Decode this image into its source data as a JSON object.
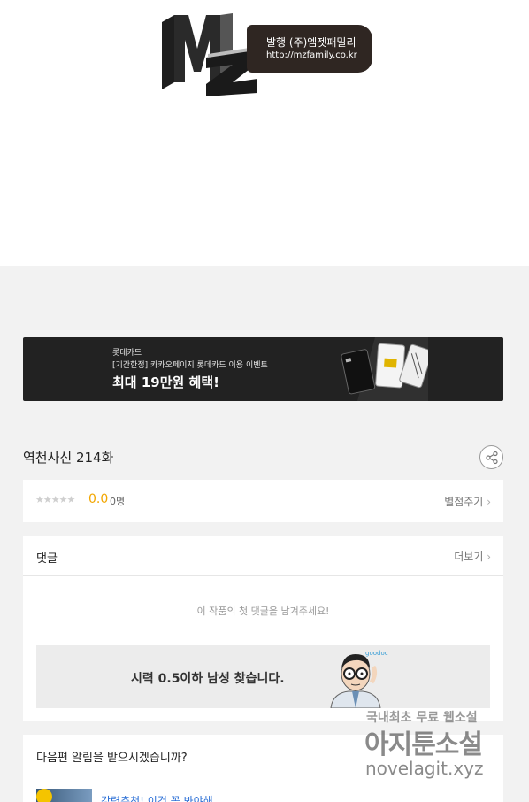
{
  "publisher": {
    "logo_text": "MZ",
    "label": "발행 (주)엠젯패밀리",
    "url": "http://mzfamily.co.kr"
  },
  "banner": {
    "brand": "롯데카드",
    "event": "[기간한정] 카카오페이지 롯데카드 이용 이벤트",
    "headline": "최대 19만원 혜택!"
  },
  "episode": {
    "title": "역천사신 214화",
    "share_icon": "share-icon"
  },
  "rating": {
    "stars": "★★★★★",
    "score": "0.0",
    "count": "0명",
    "rate_link": "별점주기"
  },
  "comments": {
    "heading": "댓글",
    "more_link": "더보기",
    "empty_message": "이 작품의 첫 댓글을 남겨주세요!"
  },
  "ad": {
    "text": "시력 0.5이하 남성 찾습니다.",
    "brand": "goodoc"
  },
  "notify": {
    "heading": "다음편 알림을 받으시겠습니까?",
    "recommend": "강력추천! 이건 꼭 봐야해"
  },
  "watermark": {
    "line1": "국내최초 무료 웹소설",
    "line2": "아지툰소설",
    "line3": "novelagit.xyz"
  },
  "colors": {
    "accent_score": "#f2a600",
    "link_blue": "#2b6fd6",
    "banner_bg": "#222222"
  }
}
